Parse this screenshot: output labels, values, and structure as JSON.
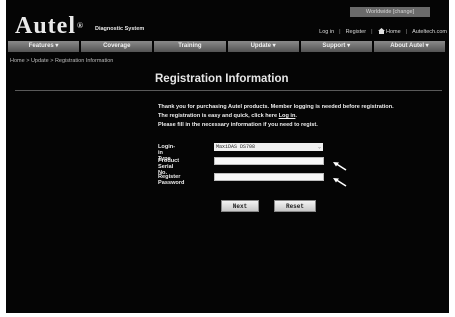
{
  "header": {
    "worldwide": "Worldwide [change]",
    "logo": "Autel",
    "logo_mark": "®",
    "tagline": "Diagnostic System",
    "links": [
      "Log in",
      "Register",
      "Home",
      "Auteltech.com"
    ]
  },
  "nav": {
    "items": [
      "Features ▾",
      "Coverage",
      "Training",
      "Update ▾",
      "Support ▾",
      "About Autel ▾"
    ]
  },
  "breadcrumb": "Home > Update > Registration Information",
  "page_title": "Registration Information",
  "intro": {
    "line1": "Thank you for purchasing Autel products. Member logging is needed before registration.",
    "line2_prefix": "The registration is easy and quick, click here ",
    "line2_link": "Log in",
    "line2_suffix": ".",
    "line3": "Please fill in the necessary information if you need to regist."
  },
  "form": {
    "login_type_label": "Login-in Type",
    "login_type_value": "MaxiDAS DS708",
    "serial_label": "Product Serial No.",
    "password_label": "Register Password"
  },
  "buttons": {
    "next": "Next",
    "reset": "Reset"
  }
}
